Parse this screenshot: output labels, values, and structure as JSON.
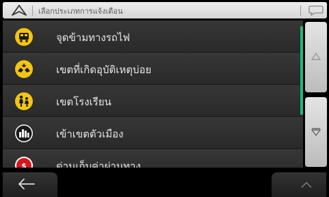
{
  "header": {
    "title": "เลือกประเภทการแจ้งเตือน",
    "nav_icon": "navigation-arrow-icon",
    "chat_icon": "speech-bubble-icon"
  },
  "list": {
    "items": [
      {
        "label": "จุดข้ามทางรถไฟ",
        "icon": "railway-crossing-icon"
      },
      {
        "label": "เขตที่เกิดอุบัติเหตุบ่อย",
        "icon": "accident-zone-icon"
      },
      {
        "label": "เขตโรงเรียน",
        "icon": "school-zone-icon"
      },
      {
        "label": "เข้าเขตตัวเมือง",
        "icon": "city-limit-icon"
      },
      {
        "label": "ด่านเก็บค่าผ่านทาง",
        "icon": "toll-booth-icon"
      }
    ],
    "scroll_position": 0.35
  },
  "side_buttons": {
    "top_icon": "triangle-up-icon",
    "bottom_icon": "triangle-down-icon"
  },
  "bottom_bar": {
    "back_icon": "back-arrow-icon",
    "up_icon": "chevron-up-icon"
  },
  "colors": {
    "accent": "#1abc7c",
    "icon_yellow": "#f2c512",
    "row_text": "#e6e6e6"
  }
}
